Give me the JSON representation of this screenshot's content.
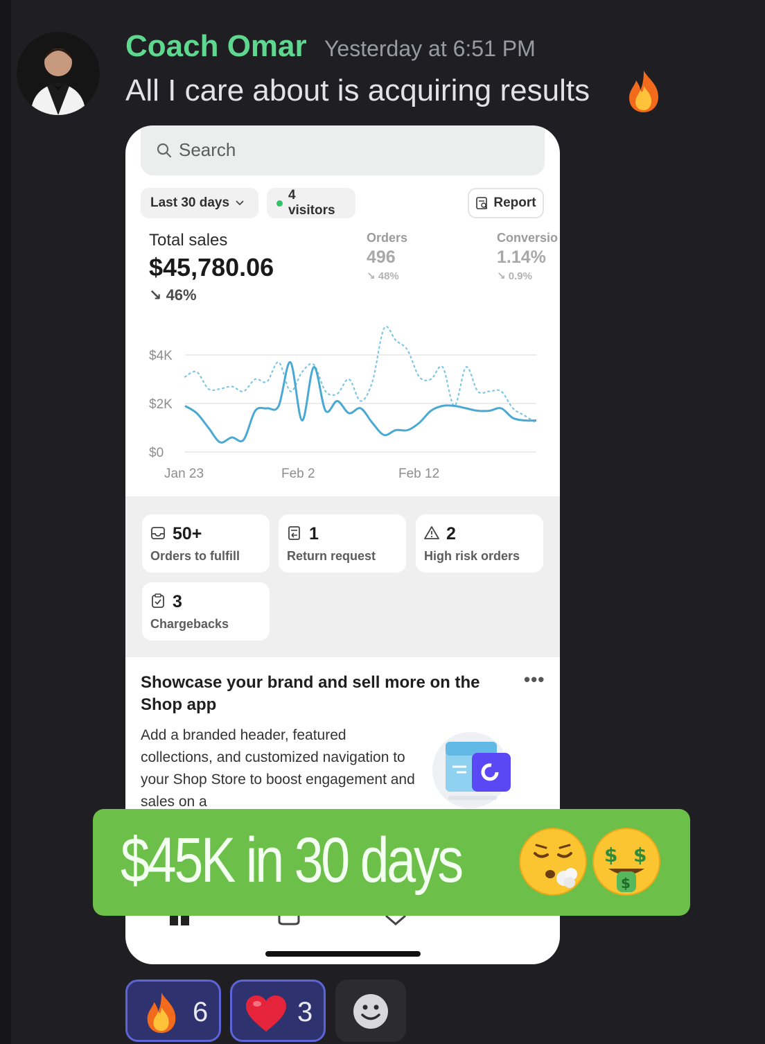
{
  "message": {
    "author": "Coach Omar",
    "timestamp": "Yesterday at 6:51 PM",
    "text": "All I care about is acquiring results",
    "author_color": "#5fd88f"
  },
  "screenshot": {
    "search_placeholder": "Search",
    "date_range": "Last 30 days",
    "visitors": "4 visitors",
    "report_label": "Report",
    "total_sales_label": "Total sales",
    "total_sales_value": "$45,780.06",
    "total_sales_change": "46%",
    "orders_label": "Orders",
    "orders_value": "496",
    "orders_change": "48%",
    "conversion_label": "Conversio",
    "conversion_value": "1.14%",
    "conversion_change": "0.9%",
    "cards": [
      {
        "value": "50+",
        "label": "Orders to fulfill",
        "icon": "inbox-icon"
      },
      {
        "value": "1",
        "label": "Return request",
        "icon": "receipt-return-icon"
      },
      {
        "value": "2",
        "label": "High risk orders",
        "icon": "warning-icon"
      },
      {
        "value": "3",
        "label": "Chargebacks",
        "icon": "clipboard-check-icon"
      }
    ],
    "promo_title": "Showcase your brand and sell more on the Shop app",
    "promo_more": "•••",
    "promo_body": "Add a branded header, featured collections, and customized navigation to your Shop Store to boost engagement and sales on a"
  },
  "chart_data": {
    "type": "line",
    "x": [
      "Jan 23",
      "Jan 24",
      "Jan 25",
      "Jan 26",
      "Jan 27",
      "Jan 28",
      "Jan 29",
      "Jan 30",
      "Jan 31",
      "Feb 1",
      "Feb 2",
      "Feb 3",
      "Feb 4",
      "Feb 5",
      "Feb 6",
      "Feb 7",
      "Feb 8",
      "Feb 9",
      "Feb 10",
      "Feb 11",
      "Feb 12",
      "Feb 13",
      "Feb 14",
      "Feb 15",
      "Feb 16",
      "Feb 17",
      "Feb 18",
      "Feb 19",
      "Feb 20",
      "Feb 21",
      "Feb 22"
    ],
    "xticks": [
      "Jan 23",
      "Feb 2",
      "Feb 12"
    ],
    "yticks": [
      "$0",
      "$2K",
      "$4K"
    ],
    "ylim": [
      0,
      4000
    ],
    "series": [
      {
        "style": "solid",
        "color": "#4aa9d3",
        "values": [
          1900,
          1600,
          1000,
          400,
          600,
          500,
          1700,
          1800,
          1900,
          3700,
          1300,
          3500,
          1700,
          2100,
          1600,
          1800,
          1200,
          700,
          900,
          900,
          1200,
          1700,
          1900,
          1900,
          1800,
          1700,
          1700,
          1800,
          1400,
          1300,
          1300
        ]
      },
      {
        "style": "dotted",
        "color": "#7cc6e4",
        "values": [
          3100,
          3300,
          2600,
          2600,
          2700,
          2500,
          3000,
          2900,
          3700,
          2500,
          3300,
          3600,
          2500,
          2400,
          3000,
          2100,
          2900,
          5100,
          4600,
          4200,
          3100,
          3000,
          3500,
          1900,
          3500,
          2500,
          2500,
          2500,
          1800,
          1500,
          1200
        ]
      }
    ]
  },
  "overlay": {
    "caption": "$45K in 30 days",
    "emoji": [
      "face-exhaling-emoji",
      "money-mouth-emoji"
    ],
    "color": "#6cc04a"
  },
  "reactions": [
    {
      "emoji": "fire-icon",
      "count": "6"
    },
    {
      "emoji": "heart-icon",
      "count": "3"
    }
  ]
}
